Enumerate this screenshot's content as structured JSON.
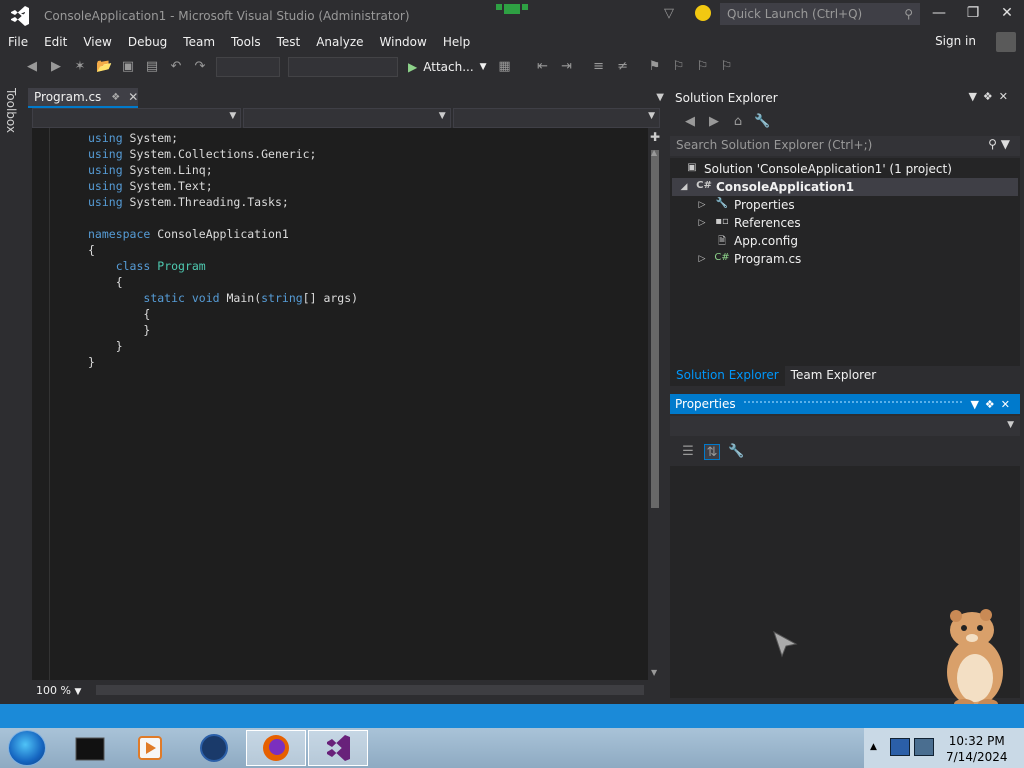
{
  "window": {
    "title": "ConsoleApplication1 - Microsoft Visual Studio (Administrator)",
    "quick_launch_placeholder": "Quick Launch (Ctrl+Q)"
  },
  "menu": [
    "File",
    "Edit",
    "View",
    "Debug",
    "Team",
    "Tools",
    "Test",
    "Analyze",
    "Window",
    "Help"
  ],
  "signin": "Sign in",
  "toolbar": {
    "attach_label": "Attach..."
  },
  "toolbox": {
    "label": "Toolbox"
  },
  "editor": {
    "tab": "Program.cs",
    "zoom": "100 %",
    "code_lines": [
      [
        [
          "kw",
          "using"
        ],
        [
          "t",
          " System;"
        ]
      ],
      [
        [
          "kw",
          "using"
        ],
        [
          "t",
          " System.Collections.Generic;"
        ]
      ],
      [
        [
          "kw",
          "using"
        ],
        [
          "t",
          " System.Linq;"
        ]
      ],
      [
        [
          "kw",
          "using"
        ],
        [
          "t",
          " System.Text;"
        ]
      ],
      [
        [
          "kw",
          "using"
        ],
        [
          "t",
          " System.Threading.Tasks;"
        ]
      ],
      [
        [
          "t",
          ""
        ]
      ],
      [
        [
          "kw",
          "namespace"
        ],
        [
          "t",
          " ConsoleApplication1"
        ]
      ],
      [
        [
          "t",
          "{"
        ]
      ],
      [
        [
          "t",
          "    "
        ],
        [
          "kw",
          "class"
        ],
        [
          "t",
          " "
        ],
        [
          "ty",
          "Program"
        ]
      ],
      [
        [
          "t",
          "    {"
        ]
      ],
      [
        [
          "t",
          "        "
        ],
        [
          "kw",
          "static"
        ],
        [
          "t",
          " "
        ],
        [
          "kw",
          "void"
        ],
        [
          "t",
          " Main("
        ],
        [
          "kw",
          "string"
        ],
        [
          "t",
          "[] args)"
        ]
      ],
      [
        [
          "t",
          "        {"
        ]
      ],
      [
        [
          "t",
          "        }"
        ]
      ],
      [
        [
          "t",
          "    }"
        ]
      ],
      [
        [
          "t",
          "}"
        ]
      ]
    ]
  },
  "solution_explorer": {
    "title": "Solution Explorer",
    "search_placeholder": "Search Solution Explorer (Ctrl+;)",
    "solution": "Solution 'ConsoleApplication1' (1 project)",
    "project": "ConsoleApplication1",
    "items": [
      "Properties",
      "References",
      "App.config",
      "Program.cs"
    ],
    "tabs": [
      "Solution Explorer",
      "Team Explorer"
    ]
  },
  "properties": {
    "title": "Properties"
  },
  "taskbar": {
    "time": "10:32 PM",
    "date": "7/14/2024"
  },
  "colors": {
    "accent": "#007acc",
    "keyword": "#569cd6",
    "type": "#4ec9b0",
    "editor_bg": "#1e1e1e"
  }
}
